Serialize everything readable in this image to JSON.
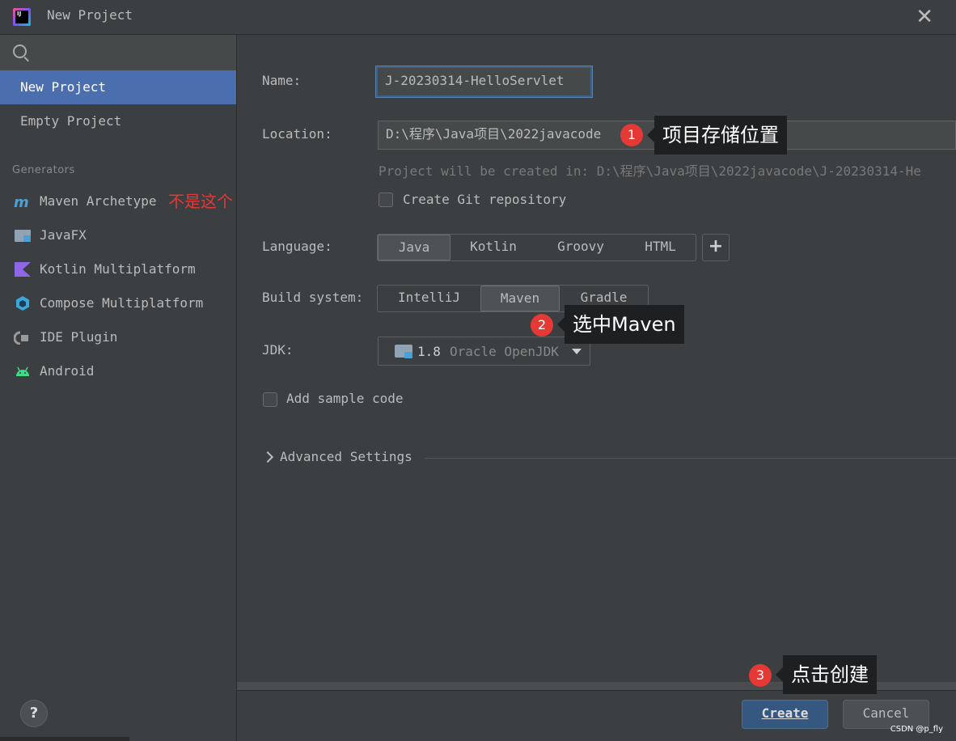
{
  "window": {
    "title": "New Project",
    "icon_text": "IJ"
  },
  "sidebar": {
    "search_placeholder": "",
    "items": [
      {
        "label": "New Project",
        "selected": true
      },
      {
        "label": "Empty Project",
        "selected": false
      }
    ],
    "generators_label": "Generators",
    "generators": [
      {
        "label": "Maven Archetype",
        "icon": "maven-icon"
      },
      {
        "label": "JavaFX",
        "icon": "javafx-icon"
      },
      {
        "label": "Kotlin Multiplatform",
        "icon": "kotlin-icon"
      },
      {
        "label": "Compose Multiplatform",
        "icon": "compose-icon"
      },
      {
        "label": "IDE Plugin",
        "icon": "plugin-icon"
      },
      {
        "label": "Android",
        "icon": "android-icon"
      }
    ],
    "maven_annotation": "不是这个"
  },
  "form": {
    "name_label": "Name:",
    "name_value": "J-20230314-HelloServlet",
    "location_label": "Location:",
    "location_value": "D:\\程序\\Java项目\\2022javacode",
    "location_hint": "Project will be created in: D:\\程序\\Java项目\\2022javacode\\J-20230314-He",
    "git_label": "Create Git repository",
    "git_checked": false,
    "language_label": "Language:",
    "languages": [
      "Java",
      "Kotlin",
      "Groovy",
      "HTML"
    ],
    "language_selected": "Java",
    "build_label": "Build system:",
    "build_systems": [
      "IntelliJ",
      "Maven",
      "Gradle"
    ],
    "build_selected": "Maven",
    "jdk_label": "JDK:",
    "jdk_version": "1.8",
    "jdk_vendor": "Oracle OpenJDK",
    "sample_label": "Add sample code",
    "sample_checked": false,
    "advanced_label": "Advanced Settings"
  },
  "buttons": {
    "create": "Create",
    "cancel": "Cancel",
    "help": "?"
  },
  "annotations": {
    "step1": {
      "num": "1",
      "text": "项目存储位置"
    },
    "step2": {
      "num": "2",
      "text": "选中Maven"
    },
    "step3": {
      "num": "3",
      "text": "点击创建"
    }
  },
  "watermark": "CSDN @p_fly",
  "colors": {
    "selection": "#4b6eaf",
    "primary_button": "#365880",
    "badge": "#e53935",
    "annotation_red": "#e53935"
  }
}
